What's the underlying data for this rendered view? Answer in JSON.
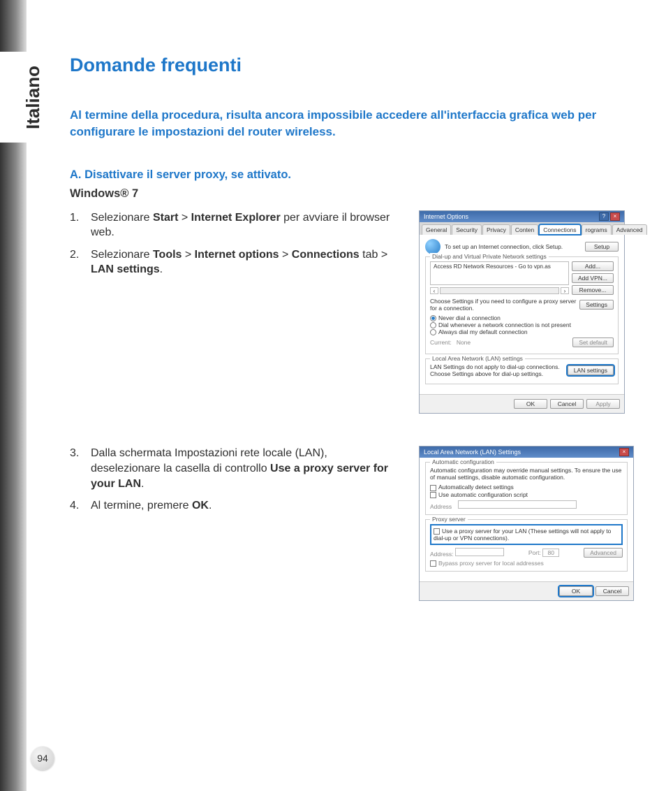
{
  "sidebar": {
    "language": "Italiano"
  },
  "page": {
    "title": "Domande frequenti",
    "intro": "Al termine della procedura, risulta ancora impossibile accedere all'interfaccia grafica web per configurare le impostazioni del router wireless.",
    "section_a_label": "A.   Disattivare il server proxy, se attivato.",
    "os_label": "Windows® 7",
    "number": "94"
  },
  "steps1": {
    "s1_pre": "Selezionare ",
    "s1_b1": "Start",
    "s1_gt1": " > ",
    "s1_b2": "Internet Explorer",
    "s1_post": " per avviare il browser web.",
    "s2_pre": "Selezionare ",
    "s2_b1": "Tools",
    "s2_gt1": " > ",
    "s2_b2": "Internet options",
    "s2_gt2": " > ",
    "s2_b3": "Connections",
    "s2_tab": " tab > ",
    "s2_b4": "LAN settings",
    "s2_post": "."
  },
  "steps2": {
    "s3_pre": "Dalla schermata Impostazioni rete locale (LAN), deselezionare la casella di controllo ",
    "s3_b1": "Use a proxy server for your LAN",
    "s3_post": ".",
    "s4_pre": "Al termine, premere ",
    "s4_b1": "OK",
    "s4_post": "."
  },
  "dlg_io": {
    "title": "Internet Options",
    "tabs": [
      "General",
      "Security",
      "Privacy",
      "Conten",
      "Connections",
      "rograms",
      "Advanced"
    ],
    "setup_text": "To set up an Internet connection, click Setup.",
    "setup_btn": "Setup",
    "vpn_legend": "Dial-up and Virtual Private Network settings",
    "vpn_item": "Access RD Network Resources - Go to vpn.as",
    "add_btn": "Add...",
    "addvpn_btn": "Add VPN...",
    "remove_btn": "Remove...",
    "choose_text": "Choose Settings if you need to configure a proxy server for a connection.",
    "settings_btn": "Settings",
    "r1": "Never dial a connection",
    "r2": "Dial whenever a network connection is not present",
    "r3": "Always dial my default connection",
    "current": "Current:",
    "none": "None",
    "setdefault_btn": "Set default",
    "lan_legend": "Local Area Network (LAN) settings",
    "lan_text": "LAN Settings do not apply to dial-up connections. Choose Settings above for dial-up settings.",
    "lan_btn": "LAN settings",
    "ok": "OK",
    "cancel": "Cancel",
    "apply": "Apply"
  },
  "dlg_lan": {
    "title": "Local Area Network (LAN) Settings",
    "auto_legend": "Automatic configuration",
    "auto_text": "Automatic configuration may override manual settings.  To ensure the use of manual settings, disable automatic configuration.",
    "auto_detect": "Automatically detect settings",
    "auto_script": "Use automatic configuration script",
    "address": "Address",
    "proxy_legend": "Proxy server",
    "proxy_use": "Use a proxy server for your LAN (These settings will not apply to dial-up or VPN connections).",
    "addr": "Address:",
    "port": "Port:",
    "port_val": "80",
    "advanced": "Advanced",
    "bypass": "Bypass proxy server for local addresses",
    "ok": "OK",
    "cancel": "Cancel"
  }
}
